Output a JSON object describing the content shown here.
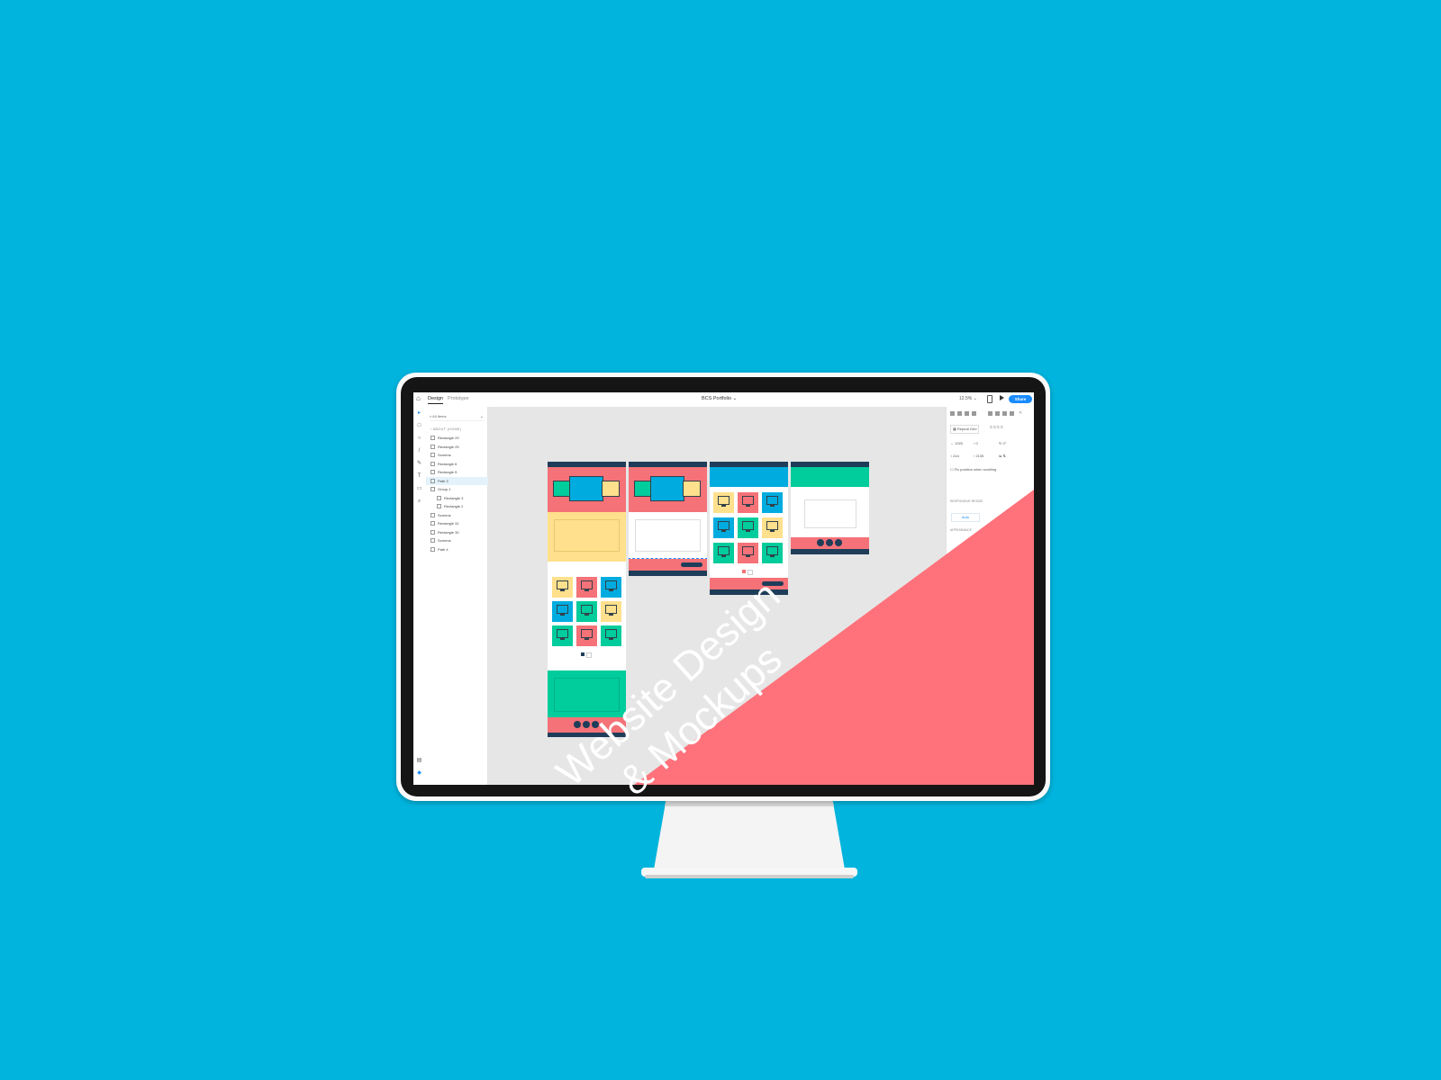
{
  "app": {
    "tabs": [
      "Design",
      "Prototype"
    ],
    "active_tab": "Design",
    "document_title": "BCS Portfolio",
    "zoom": "12.5%",
    "share_label": "Share"
  },
  "layers": {
    "search_placeholder": "All Items",
    "section": "ABOUT (HOME)",
    "items": [
      "Rectangle 29",
      "Rectangle 25",
      "Screens",
      "Rectangle 6",
      "Rectangle 5",
      "Path 3",
      "Group 1",
      "Rectangle 3",
      "Rectangle 2",
      "Screens",
      "Rectangle 31",
      "Rectangle 30",
      "Screens",
      "Path 4"
    ],
    "selected_item": "Path 3"
  },
  "properties": {
    "repeat_grid": "Repeat Grid",
    "w": "1920",
    "x": "0",
    "rotation": "0°",
    "h": "244",
    "y": "2135",
    "fix_position": "Fix position when scrolling",
    "responsive_resize": "RESPONSIVE RESIZE",
    "auto": "Auto",
    "appearance": "APPEARANCE"
  },
  "banner": {
    "line1": "Website Design",
    "line2": "& Mockups",
    "color": "#ff727b"
  },
  "colors": {
    "background": "#00b4dd",
    "coral": "#f47278",
    "yellow": "#ffe08c",
    "blue": "#00acdf",
    "green": "#00cc9c",
    "navy": "#1e3d59"
  }
}
